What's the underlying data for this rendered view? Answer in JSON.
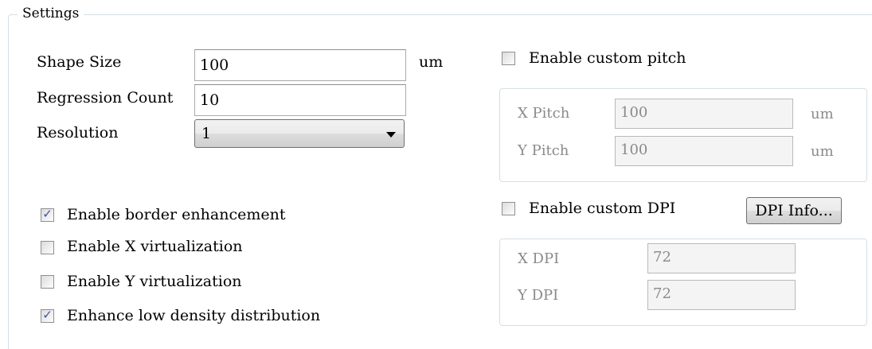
{
  "settings": {
    "title": "Settings",
    "shape_size": {
      "label": "Shape Size",
      "value": "100",
      "unit": "um"
    },
    "regression_count": {
      "label": "Regression Count",
      "value": "10"
    },
    "resolution": {
      "label": "Resolution",
      "value": "1"
    },
    "checkboxes": [
      {
        "label": "Enable border enhancement",
        "checked": true
      },
      {
        "label": "Enable X virtualization",
        "checked": false
      },
      {
        "label": "Enable Y virtualization",
        "checked": false
      },
      {
        "label": "Enhance low density distribution",
        "checked": true
      }
    ],
    "custom_pitch": {
      "label": "Enable custom pitch",
      "checked": false,
      "x_label": "X Pitch",
      "x_value": "100",
      "x_unit": "um",
      "y_label": "Y Pitch",
      "y_value": "100",
      "y_unit": "um"
    },
    "custom_dpi": {
      "label": "Enable custom DPI",
      "checked": false,
      "button_label": "DPI Info...",
      "x_label": "X DPI",
      "x_value": "72",
      "y_label": "Y DPI",
      "y_value": "72"
    }
  }
}
